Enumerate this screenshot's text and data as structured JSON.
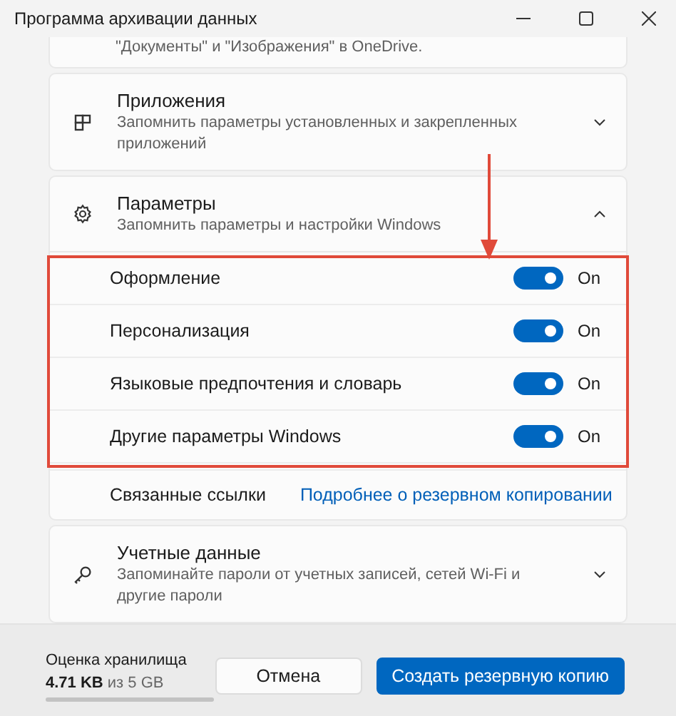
{
  "window": {
    "title": "Программа архивации данных"
  },
  "sections": [
    {
      "kind": "text",
      "subtitle": "\"Документы\" и \"Изображения\" в OneDrive."
    },
    {
      "kind": "card",
      "title": "Приложения",
      "subtitle": "Запомнить параметры установленных и закрепленных приложений",
      "expanded": false
    },
    {
      "kind": "card",
      "title": "Параметры",
      "subtitle": "Запомнить параметры и настройки Windows",
      "expanded": true,
      "options": [
        {
          "label": "Оформление",
          "on": true,
          "state": "On"
        },
        {
          "label": "Персонализация",
          "on": true,
          "state": "On"
        },
        {
          "label": "Языковые предпочтения и словарь",
          "on": true,
          "state": "On"
        },
        {
          "label": "Другие параметры Windows",
          "on": true,
          "state": "On"
        }
      ],
      "related": {
        "label": "Связанные ссылки",
        "link": "Подробнее о резервном копировании"
      }
    },
    {
      "kind": "card",
      "title": "Учетные данные",
      "subtitle": "Запоминайте пароли от учетных записей, сетей Wi-Fi и другие пароли",
      "expanded": false
    }
  ],
  "footer": {
    "label": "Оценка хранилища",
    "amount": "**4.71 KB** из 5 GB",
    "buttons": [
      {
        "label": "Отмена",
        "kind": "secondary"
      },
      {
        "label": "Создать резервную копию",
        "kind": "primary"
      }
    ]
  }
}
